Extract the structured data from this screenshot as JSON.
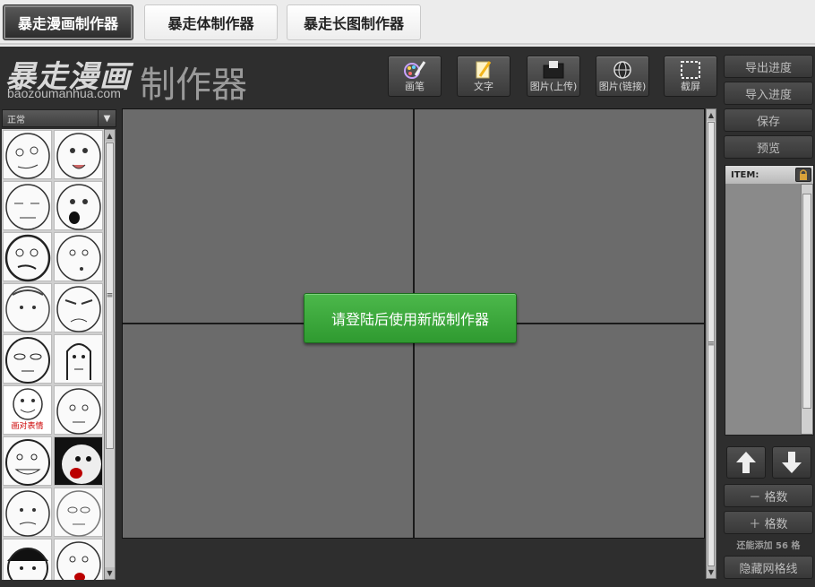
{
  "tabs": [
    {
      "label": "暴走漫画制作器",
      "active": true
    },
    {
      "label": "暴走体制作器",
      "active": false
    },
    {
      "label": "暴走长图制作器",
      "active": false
    }
  ],
  "logo": {
    "title": "暴走漫画",
    "subtitle": "制作器",
    "url": "baozoumanhua.com"
  },
  "toolbar": {
    "pen": "画笔",
    "text": "文字",
    "image_upload": "图片(上传)",
    "image_link": "图片(链接)",
    "screenshot": "截屏"
  },
  "sidebar": {
    "mode_value": "正常",
    "special_face_label": "画对表情"
  },
  "canvas": {
    "login_prompt": "请登陆后使用新版制作器"
  },
  "right_panel": {
    "export": "导出进度",
    "import": "导入进度",
    "save": "保存",
    "preview": "预览",
    "item_header": "ITEM:",
    "minus_grid": "－ 格数",
    "plus_grid": "＋ 格数",
    "remaining": "还能添加 56 格",
    "hide_grid": "隐藏网格线"
  },
  "colors": {
    "accent_green": "#3aa83a",
    "app_bg": "#2e2e2e",
    "canvas_bg": "#6b6b6b"
  }
}
